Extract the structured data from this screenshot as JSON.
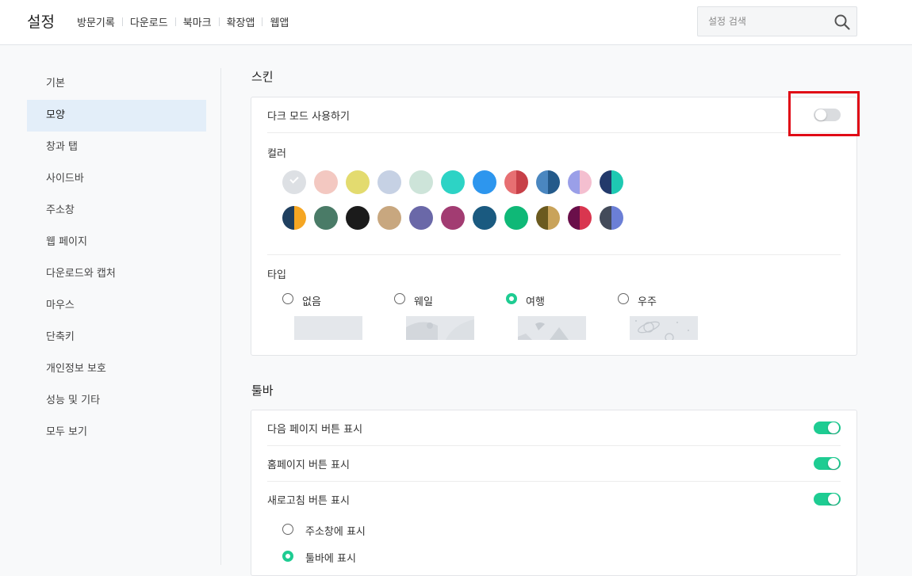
{
  "app": {
    "title": "설정"
  },
  "top_nav": [
    "방문기록",
    "다운로드",
    "북마크",
    "확장앱",
    "웹앱"
  ],
  "search": {
    "placeholder": "설정 검색"
  },
  "sidebar": {
    "items": [
      {
        "label": "기본"
      },
      {
        "label": "모양",
        "active": true
      },
      {
        "label": "창과 탭"
      },
      {
        "label": "사이드바"
      },
      {
        "label": "주소창"
      },
      {
        "label": "웹 페이지"
      },
      {
        "label": "다운로드와 캡처"
      },
      {
        "label": "마우스"
      },
      {
        "label": "단축키"
      },
      {
        "label": "개인정보 보호"
      },
      {
        "label": "성능 및 기타"
      },
      {
        "label": "모두 보기"
      }
    ]
  },
  "skin": {
    "title": "스킨",
    "dark_mode": {
      "label": "다크 모드 사용하기",
      "enabled": false
    },
    "color": {
      "label": "컬러",
      "swatches": [
        [
          {
            "colors": [
              "#dde0e4"
            ],
            "selected": true
          },
          {
            "colors": [
              "#f3c8c1"
            ]
          },
          {
            "colors": [
              "#e3db6f"
            ]
          },
          {
            "colors": [
              "#c6d1e4"
            ]
          },
          {
            "colors": [
              "#cde4d9"
            ]
          },
          {
            "colors": [
              "#2dd3c5"
            ]
          },
          {
            "colors": [
              "#2d96ee"
            ]
          },
          {
            "colors": [
              "#e76f72",
              "#c74048"
            ]
          },
          {
            "colors": [
              "#4a87c0",
              "#245a8a"
            ]
          },
          {
            "colors": [
              "#9a9fe8",
              "#f4bfd0"
            ]
          },
          {
            "colors": [
              "#233a6b",
              "#1ec9b2"
            ]
          }
        ],
        [
          {
            "colors": [
              "#1f3f5f",
              "#f5a623"
            ]
          },
          {
            "colors": [
              "#4a7b67"
            ]
          },
          {
            "colors": [
              "#1b1b1b"
            ]
          },
          {
            "colors": [
              "#c8a77f"
            ]
          },
          {
            "colors": [
              "#6a68a8"
            ]
          },
          {
            "colors": [
              "#a23c72"
            ]
          },
          {
            "colors": [
              "#1a5a80"
            ]
          },
          {
            "colors": [
              "#0fb877"
            ]
          },
          {
            "colors": [
              "#6b5a1f",
              "#c9a35a"
            ]
          },
          {
            "colors": [
              "#6a0f4a",
              "#d9364f"
            ]
          },
          {
            "colors": [
              "#434b5a",
              "#6b7fd6"
            ]
          }
        ]
      ]
    },
    "type": {
      "label": "타입",
      "options": [
        {
          "label": "없음",
          "checked": false
        },
        {
          "label": "웨일",
          "checked": false
        },
        {
          "label": "여행",
          "checked": true
        },
        {
          "label": "우주",
          "checked": false
        }
      ]
    }
  },
  "toolbar": {
    "title": "툴바",
    "rows": [
      {
        "label": "다음 페이지 버튼 표시",
        "enabled": true
      },
      {
        "label": "홈페이지 버튼 표시",
        "enabled": true
      },
      {
        "label": "새로고침 버튼 표시",
        "enabled": true
      }
    ],
    "refresh_options": [
      {
        "label": "주소창에 표시",
        "checked": false
      },
      {
        "label": "툴바에 표시",
        "checked": true
      }
    ]
  },
  "theme": {
    "accent": "#1ecc92",
    "highlight": "#e00a16",
    "active_bg": "#e3eef9"
  }
}
